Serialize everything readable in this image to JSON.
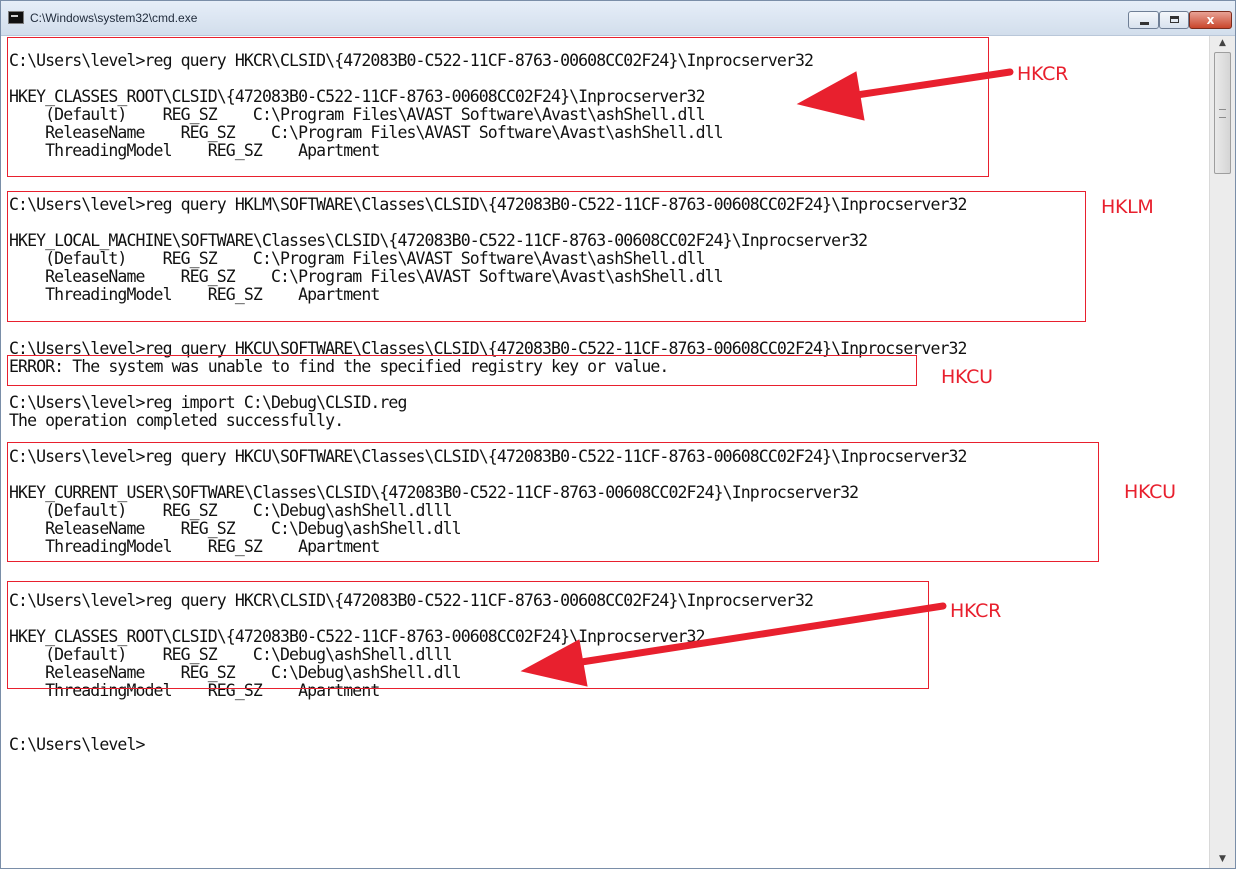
{
  "window": {
    "title": "C:\\Windows\\system32\\cmd.exe",
    "close_glyph": "x",
    "icons": [
      "cmd-console-icon",
      "minimize-icon",
      "maximize-icon",
      "close-icon",
      "scroll-up-arrow-icon",
      "scroll-down-arrow-icon"
    ]
  },
  "console": {
    "lines": [
      "C:\\Users\\level>reg query HKCR\\CLSID\\{472083B0-C522-11CF-8763-00608CC02F24}\\Inprocserver32",
      "",
      "HKEY_CLASSES_ROOT\\CLSID\\{472083B0-C522-11CF-8763-00608CC02F24}\\Inprocserver32",
      "    (Default)    REG_SZ    C:\\Program Files\\AVAST Software\\Avast\\ashShell.dll",
      "    ReleaseName    REG_SZ    C:\\Program Files\\AVAST Software\\Avast\\ashShell.dll",
      "    ThreadingModel    REG_SZ    Apartment",
      "",
      "",
      "C:\\Users\\level>reg query HKLM\\SOFTWARE\\Classes\\CLSID\\{472083B0-C522-11CF-8763-00608CC02F24}\\Inprocserver32",
      "",
      "HKEY_LOCAL_MACHINE\\SOFTWARE\\Classes\\CLSID\\{472083B0-C522-11CF-8763-00608CC02F24}\\Inprocserver32",
      "    (Default)    REG_SZ    C:\\Program Files\\AVAST Software\\Avast\\ashShell.dll",
      "    ReleaseName    REG_SZ    C:\\Program Files\\AVAST Software\\Avast\\ashShell.dll",
      "    ThreadingModel    REG_SZ    Apartment",
      "",
      "",
      "C:\\Users\\level>reg query HKCU\\SOFTWARE\\Classes\\CLSID\\{472083B0-C522-11CF-8763-00608CC02F24}\\Inprocserver32",
      "ERROR: The system was unable to find the specified registry key or value.",
      "",
      "C:\\Users\\level>reg import C:\\Debug\\CLSID.reg",
      "The operation completed successfully.",
      "",
      "C:\\Users\\level>reg query HKCU\\SOFTWARE\\Classes\\CLSID\\{472083B0-C522-11CF-8763-00608CC02F24}\\Inprocserver32",
      "",
      "HKEY_CURRENT_USER\\SOFTWARE\\Classes\\CLSID\\{472083B0-C522-11CF-8763-00608CC02F24}\\Inprocserver32",
      "    (Default)    REG_SZ    C:\\Debug\\ashShell.dlll",
      "    ReleaseName    REG_SZ    C:\\Debug\\ashShell.dll",
      "    ThreadingModel    REG_SZ    Apartment",
      "",
      "",
      "C:\\Users\\level>reg query HKCR\\CLSID\\{472083B0-C522-11CF-8763-00608CC02F24}\\Inprocserver32",
      "",
      "HKEY_CLASSES_ROOT\\CLSID\\{472083B0-C522-11CF-8763-00608CC02F24}\\Inprocserver32",
      "    (Default)    REG_SZ    C:\\Debug\\ashShell.dlll",
      "    ReleaseName    REG_SZ    C:\\Debug\\ashShell.dll",
      "    ThreadingModel    REG_SZ    Apartment",
      "",
      "",
      "C:\\Users\\level>"
    ]
  },
  "annotations": {
    "color": "#e8202e",
    "labels": [
      "HKCR",
      "HKLM",
      "HKCU",
      "HKCU",
      "HKCR"
    ]
  },
  "theme": {
    "console_background": "#ffffff",
    "console_text": "#111111",
    "titlebar": "#dbe5f1"
  }
}
